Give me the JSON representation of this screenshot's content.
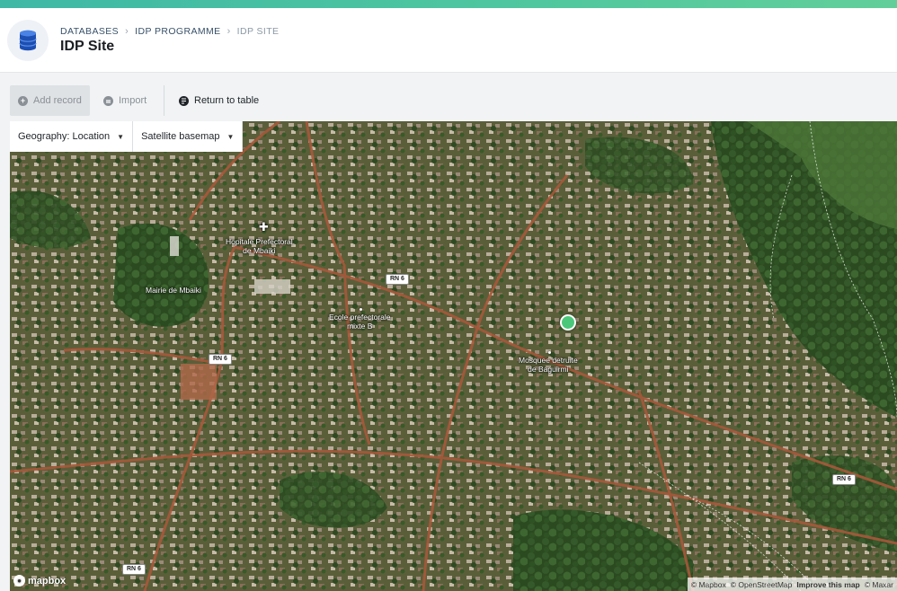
{
  "breadcrumb": {
    "items": [
      "DATABASES",
      "IDP PROGRAMME",
      "IDP SITE"
    ],
    "separator": "›"
  },
  "page": {
    "title": "IDP Site"
  },
  "toolbar": {
    "add_record": "Add record",
    "import": "Import",
    "return_to_table": "Return to table"
  },
  "map": {
    "geography_selector": "Geography: Location",
    "basemap_selector": "Satellite basemap",
    "labels": {
      "hospital": [
        "Hopitale Prefectoral",
        "de Mbaiki"
      ],
      "mairie": "Mairie de Mbaiki",
      "school": [
        "Ecole prefectorale",
        "mixte B"
      ],
      "mosque": [
        "Mosquee detruite",
        "de Baguirmi"
      ]
    },
    "road_shields": [
      "RN 6",
      "RN 6",
      "RN 6",
      "RN 6"
    ],
    "logo": "mapbox",
    "attribution": {
      "mapbox": "© Mapbox",
      "osm": "© OpenStreetMap",
      "improve": "Improve this map",
      "maxar": "© Maxar"
    }
  },
  "colors": {
    "accent": "#4cc5a0",
    "marker": "#4bc77a"
  },
  "icons": {
    "database": "database-icon",
    "add": "plus-circle-icon",
    "import": "import-icon",
    "return": "table-icon"
  }
}
